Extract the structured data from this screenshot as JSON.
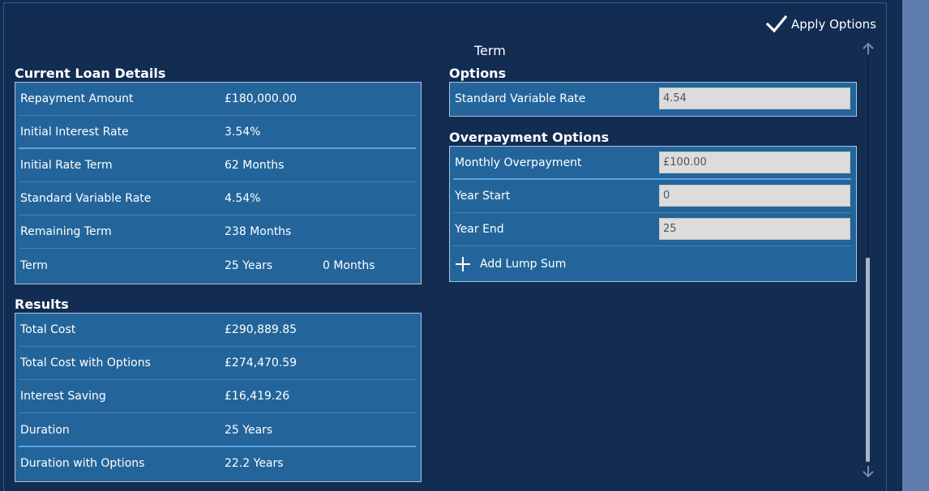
{
  "header": {
    "apply_label": "Apply Options",
    "term_title": "Term"
  },
  "current_loan": {
    "title": "Current Loan Details",
    "rows": [
      {
        "label": "Repayment Amount",
        "value": "£180,000.00"
      },
      {
        "label": "Initial Interest Rate",
        "value": "3.54%"
      },
      {
        "label": "Initial Rate Term",
        "value": "62 Months"
      },
      {
        "label": "Standard Variable Rate",
        "value": "4.54%"
      },
      {
        "label": "Remaining Term",
        "value": "238 Months"
      },
      {
        "label": "Term",
        "value": "25 Years",
        "value2": "0 Months"
      }
    ]
  },
  "results": {
    "title": "Results",
    "rows": [
      {
        "label": "Total Cost",
        "value": "£290,889.85"
      },
      {
        "label": "Total Cost with Options",
        "value": "£274,470.59"
      },
      {
        "label": "Interest Saving",
        "value": "£16,419.26"
      },
      {
        "label": "Duration",
        "value": "25 Years"
      },
      {
        "label": "Duration with Options",
        "value": "22.2 Years"
      }
    ]
  },
  "options": {
    "title": "Options",
    "svr_label": "Standard Variable Rate",
    "svr_value": "4.54"
  },
  "overpayment": {
    "title": "Overpayment Options",
    "monthly_label": "Monthly Overpayment",
    "monthly_value": "£100.00",
    "year_start_label": "Year Start",
    "year_start_value": "0",
    "year_end_label": "Year End",
    "year_end_value": "25",
    "add_lump_label": "Add Lump Sum"
  },
  "icons": {
    "apply": "checkmark-icon",
    "add": "plus-icon",
    "scroll_up": "arrow-up-icon",
    "scroll_down": "arrow-down-icon"
  },
  "colors": {
    "background": "#122c52",
    "panel": "#23659a",
    "panel_border": "#a9c4df",
    "input_bg": "#dcdcdc",
    "side_strip": "#5f7ead"
  }
}
